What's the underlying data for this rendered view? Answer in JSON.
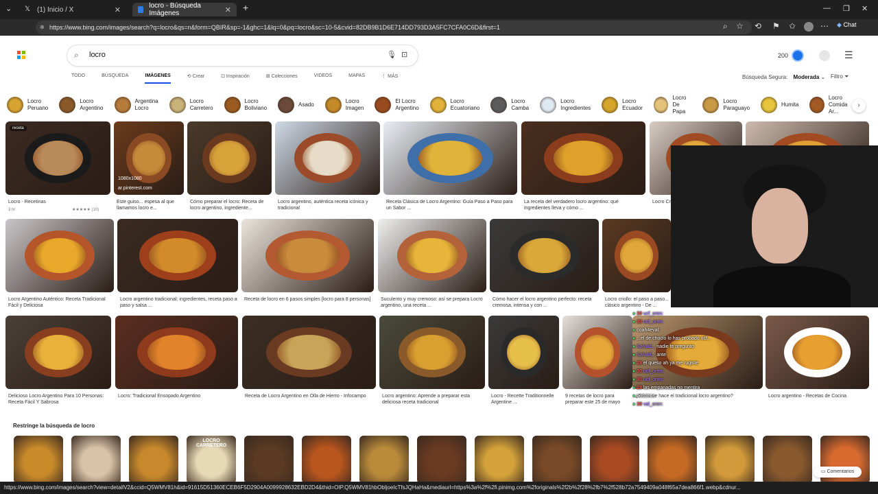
{
  "tabs": [
    {
      "title": "(1) Inicio / X"
    },
    {
      "title": "locro - Búsqueda Imágenes"
    }
  ],
  "address": {
    "url": "https://www.bing.com/images/search?q=locro&qs=n&form=QBIR&sp=-1&ghc=1&lq=0&pq=locro&sc=10-5&cvid=82DB9B1D6E714DD793D3A5FC7CFA0C6D&first=1"
  },
  "browser": {
    "chat_label": "Chat"
  },
  "search": {
    "query": "locro"
  },
  "header": {
    "rewards_points": "200"
  },
  "scopes": [
    {
      "label": "TODO"
    },
    {
      "label": "BÚSQUEDA"
    },
    {
      "label": "IMÁGENES"
    },
    {
      "label": "Crear"
    },
    {
      "label": "Inspiración"
    },
    {
      "label": "Colecciones"
    },
    {
      "label": "VIDEOS"
    },
    {
      "label": "MAPAS"
    },
    {
      "label": "MÁS"
    }
  ],
  "safesearch": {
    "label": "Búsqueda Segura:",
    "value": "Moderada",
    "filter_label": "Filtro"
  },
  "chips": [
    {
      "label": "Locro\nPeruano",
      "color": "#d8a431"
    },
    {
      "label": "Locro\nArgentino",
      "color": "#8a5a2b"
    },
    {
      "label": "Argentina\nLocro",
      "color": "#b57b3a"
    },
    {
      "label": "Locro\nCarretero",
      "color": "#c9b27a"
    },
    {
      "label": "Locro\nBoliviano",
      "color": "#9b5b20"
    },
    {
      "label": "Asado",
      "color": "#6b4a3a"
    },
    {
      "label": "Locro\nImagen",
      "color": "#c58a28"
    },
    {
      "label": "El Locro\nArgentino",
      "color": "#9a4a1f"
    },
    {
      "label": "Locro\nEcuatoriano",
      "color": "#e0b23a"
    },
    {
      "label": "Locro\nCamba",
      "color": "#5c5c5c"
    },
    {
      "label": "Locro\nIngredientes",
      "color": "#dfe9f2"
    },
    {
      "label": "Locro\nEcuador",
      "color": "#d4a52a"
    },
    {
      "label": "Locro\nDe Papa",
      "color": "#e3c27a"
    },
    {
      "label": "Locro\nParaguayo",
      "color": "#c89a44"
    },
    {
      "label": "Humita",
      "color": "#e6c43b"
    },
    {
      "label": "Locro\nComida Ar...",
      "color": "#a45a25"
    }
  ],
  "results": [
    {
      "caption": "Locro - Recetinas",
      "sub": "3 hr",
      "rating": "★★★★★ (10)",
      "bg": "#3b2a22",
      "bowl": "#1a1a1a",
      "stew": "#b98a5a"
    },
    {
      "caption": "Este guiso... espesa al que llamamos locro e...",
      "size": "1080x1080",
      "source": "ar.pinterest.com",
      "bg": "#6a3b1c",
      "bowl": "#8a4a24",
      "stew": "#c58a3a"
    },
    {
      "caption": "Cómo preparar el locro: Receta de locro argentino, ingrediente...",
      "bg": "#4a3a2a",
      "bowl": "#6b3a1e",
      "stew": "#d6a23a"
    },
    {
      "caption": "Locro argentino, auténtica receta icónica y tradicional",
      "bg": "#cfd9e6",
      "bowl": "#9b4a2a",
      "stew": "#e7dcc7"
    },
    {
      "caption": "Receta Clásica de Locro Argentino: Guía Paso a Paso para un Sabor ...",
      "bg": "#e8edf4",
      "bowl": "#3e6fa8",
      "stew": "#e0b43a"
    },
    {
      "caption": "La receta del verdadero locro argentino: qué ingredientes lleva y cómo ...",
      "bg": "#4a2e1e",
      "bowl": "#8a3c1c",
      "stew": "#dfa12a"
    },
    {
      "caption": "Locro Cri... De Locr...",
      "bg": "#d8cdc4",
      "bowl": "#a14b24",
      "stew": "#e2a83a"
    },
    {
      "caption": "",
      "bg": "#cdb9ad",
      "bowl": "#a24a22",
      "stew": "#e0a035"
    },
    {
      "caption": "Locro Argentino Auténtico: Receta Tradicional Fácil y Deliciosa",
      "bg": "#c9c5c8",
      "bowl": "#b5552a",
      "stew": "#e9a82a"
    },
    {
      "caption": "Locro argentino tradicional: ingredientes, receta paso a paso y salsa ...",
      "bg": "#3a2a22",
      "bowl": "#9e3f1c",
      "stew": "#d28a2a"
    },
    {
      "caption": "Receta de locro en 6 pasos simples [locro para 8 personas]",
      "bg": "#eae4dd",
      "bowl": "#b45a32",
      "stew": "#c98b3c"
    },
    {
      "caption": "Suculento y muy cremoso: así se prepara Locro argentino, una receta ...",
      "bg": "#eeeeee",
      "bowl": "#b4623a",
      "stew": "#e6b53a"
    },
    {
      "caption": "Cómo hacer el locro argentino perfecto: receta cremosa, intensa y con ...",
      "bg": "#3a3a3a",
      "bowl": "#2b2b2b",
      "stew": "#d8a83a"
    },
    {
      "caption": "Locro criollo: el paso a paso... clásico argentino - De ...",
      "bg": "#5a3a22",
      "bowl": "#9a4a22",
      "stew": "#e0a83a"
    },
    {
      "caption": "Delicioso Locro Argentino Para 10 Personas: Receta Fácil Y Sabrosa",
      "bg": "#4a4038",
      "bowl": "#8a3e20",
      "stew": "#e8b23a"
    },
    {
      "caption": "Locro: Tradicional Ensopado Argentino",
      "bg": "#5a2e20",
      "bowl": "#8f3a1c",
      "stew": "#e2822a"
    },
    {
      "caption": "Receta de Locro Argentino en Olla de Hierro - Infocampo",
      "bg": "#3a2e24",
      "bowl": "#6b3a22",
      "stew": "#c7a458"
    },
    {
      "caption": "Locro argentino: Aprende a preparar esta deliciosa receta tradicional",
      "bg": "#4a4a3a",
      "bowl": "#8a5a2a",
      "stew": "#d8a030"
    },
    {
      "caption": "Locro - Recette Traditionnelle Argentine ...",
      "bg": "#3a3a3a",
      "bowl": "#2a2a2a",
      "stew": "#e6c04a"
    },
    {
      "caption": "9 recetas de locro para preparar este 25 de mayo",
      "bg": "#e6e0da",
      "bowl": "#b3522c",
      "stew": "#e6a63a"
    },
    {
      "caption": "¿Cómo se hace el tradicional locro argentino?",
      "bg": "#b9966e",
      "bowl": "#7a3a1e",
      "stew": "#e4aa3a"
    },
    {
      "caption": "Locro argentino - Recetas de Cocina",
      "bg": "#7a5a4a",
      "bowl": "#ffffff",
      "stew": "#e8a030"
    }
  ],
  "restringe": {
    "title": "Restringe la búsqueda de locro"
  },
  "strip_colors": [
    "#c98a2a",
    "#d9c3a8",
    "#c7892c",
    "#e8d9b6",
    "#5a3a22",
    "#b9561e",
    "#b88a3a",
    "#6a3a22",
    "#d4a23a",
    "#7a4a28",
    "#a84a22",
    "#c56a24",
    "#d29a3a",
    "#8a5a2e",
    "#d86a30"
  ],
  "strip_label": "LOCRO CARRETERO",
  "chat": [
    {
      "num": "30",
      "user": "ucf_oren:",
      "msg": ""
    },
    {
      "num": "30",
      "user": "ucf_oren:",
      "msg": ""
    },
    {
      "num": "",
      "user": "",
      "msg": "coah4eval:"
    },
    {
      "num": "",
      "user": "",
      "msg": "...el de choclo lo has probado ucf..."
    },
    {
      "num": "",
      "user": "Salvad...",
      "msg": "nadie te pregunto"
    },
    {
      "num": "",
      "user": "Salvad...",
      "msg": "ante"
    },
    {
      "num": "28",
      "user": "",
      "msg": "el queso ah ya me rugiste"
    },
    {
      "num": "30",
      "user": "ucf_oren:",
      "msg": ""
    },
    {
      "num": "30",
      "user": "ucf_oren:",
      "msg": ""
    },
    {
      "num": "28",
      "user": "",
      "msg": "las empanadas no mentira"
    },
    {
      "num": "",
      "user": "",
      "msg": "nosotros"
    },
    {
      "num": "30",
      "user": "val_oren:",
      "msg": ""
    }
  ],
  "feedback": {
    "label": "Comentarios"
  },
  "statusbar": {
    "text": "https://www.bing.com/images/search?view=detailV2&ccid=Q5WMV81h&id=91615D51360ECEB6F5D2904A0099928632EBD2D4&thid=OIP.Q5WMV81hbObljoeIcTfsJQHaHa&mediaurl=https%3a%2f%2fi.pinimg.com%2foriginals%2f2b%2f28%2fb7%2f528b72a7549409a048f65a7dea866f1.webp&cdnur..."
  }
}
